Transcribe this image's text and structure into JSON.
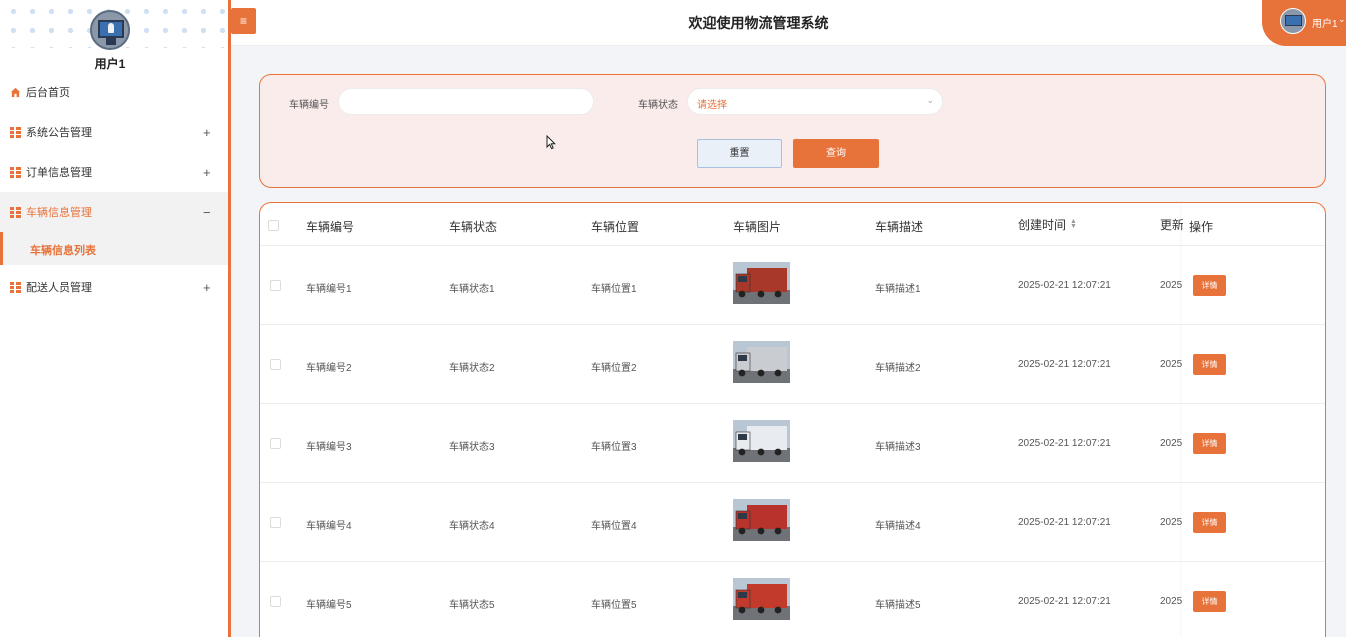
{
  "sidebar": {
    "username": "用户1",
    "items": [
      {
        "label": "后台首页",
        "sign": ""
      },
      {
        "label": "系统公告管理",
        "sign": "+"
      },
      {
        "label": "订单信息管理",
        "sign": "+"
      },
      {
        "label": "车辆信息管理",
        "sign": "−"
      },
      {
        "label": "车辆信息列表",
        "sign": ""
      },
      {
        "label": "配送人员管理",
        "sign": "+"
      }
    ]
  },
  "header": {
    "menu_toggle": "≡",
    "title": "欢迎使用物流管理系统",
    "user": "用户1",
    "caret": "⌄"
  },
  "search": {
    "vehicle_no_label": "车辆编号",
    "vehicle_no_value": "",
    "status_label": "车辆状态",
    "status_placeholder": "请选择",
    "reset_label": "重置",
    "query_label": "查询"
  },
  "table": {
    "columns": [
      "车辆编号",
      "车辆状态",
      "车辆位置",
      "车辆图片",
      "车辆描述",
      "创建时间",
      "更新",
      "操作"
    ],
    "sort_icon": "▲▼",
    "rows": [
      {
        "no": "车辆编号1",
        "status": "车辆状态1",
        "location": "车辆位置1",
        "desc": "车辆描述1",
        "created": "2025-02-21 12:07:21",
        "updated": "2025",
        "action": "详情",
        "img_color": "#a8382a"
      },
      {
        "no": "车辆编号2",
        "status": "车辆状态2",
        "location": "车辆位置2",
        "desc": "车辆描述2",
        "created": "2025-02-21 12:07:21",
        "updated": "2025",
        "action": "详情",
        "img_color": "#c9ccd1"
      },
      {
        "no": "车辆编号3",
        "status": "车辆状态3",
        "location": "车辆位置3",
        "desc": "车辆描述3",
        "created": "2025-02-21 12:07:21",
        "updated": "2025",
        "action": "详情",
        "img_color": "#e8ecf0"
      },
      {
        "no": "车辆编号4",
        "status": "车辆状态4",
        "location": "车辆位置4",
        "desc": "车辆描述4",
        "created": "2025-02-21 12:07:21",
        "updated": "2025",
        "action": "详情",
        "img_color": "#b8332b"
      },
      {
        "no": "车辆编号5",
        "status": "车辆状态5",
        "location": "车辆位置5",
        "desc": "车辆描述5",
        "created": "2025-02-21 12:07:21",
        "updated": "2025",
        "action": "详情",
        "img_color": "#c23a2c"
      }
    ]
  },
  "colors": {
    "accent": "#e8733a",
    "panel_bg": "#f9eceb"
  }
}
